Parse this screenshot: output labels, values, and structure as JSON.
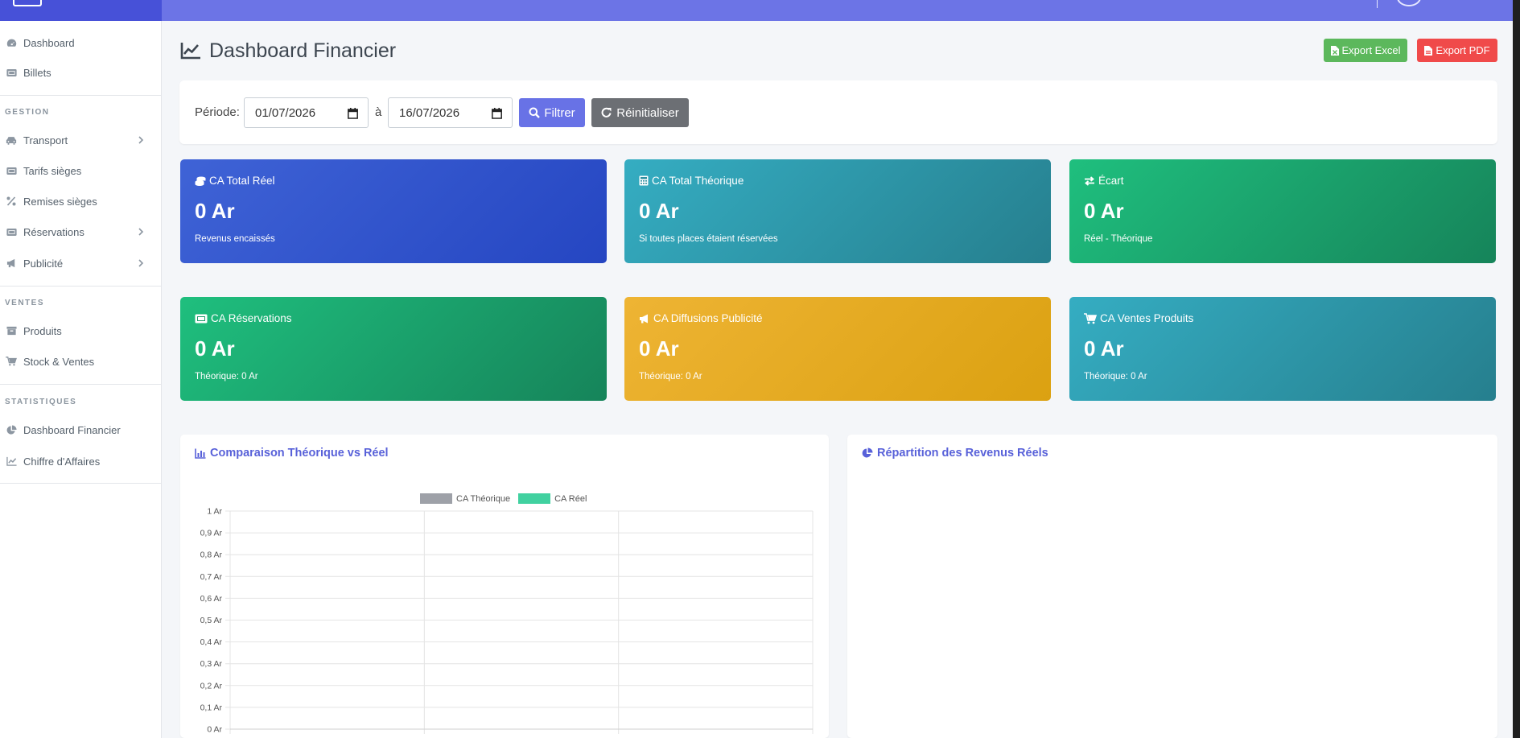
{
  "sidebar": {
    "items_top": [
      {
        "label": "Dashboard",
        "icon": "dashboard-icon"
      },
      {
        "label": "Billets",
        "icon": "ticket-icon"
      }
    ],
    "sections": [
      {
        "title": "GESTION",
        "items": [
          {
            "label": "Transport",
            "icon": "car-icon",
            "has_children": true
          },
          {
            "label": "Tarifs sièges",
            "icon": "ticket-icon",
            "has_children": false
          },
          {
            "label": "Remises sièges",
            "icon": "percent-icon",
            "has_children": false
          },
          {
            "label": "Réservations",
            "icon": "ticket-icon",
            "has_children": true
          },
          {
            "label": "Publicité",
            "icon": "megaphone-icon",
            "has_children": true
          }
        ]
      },
      {
        "title": "VENTES",
        "items": [
          {
            "label": "Produits",
            "icon": "box-icon",
            "has_children": false
          },
          {
            "label": "Stock & Ventes",
            "icon": "cart-icon",
            "has_children": false
          }
        ]
      },
      {
        "title": "STATISTIQUES",
        "items": [
          {
            "label": "Dashboard Financier",
            "icon": "pie-chart-icon",
            "has_children": false
          },
          {
            "label": "Chiffre d'Affaires",
            "icon": "line-chart-icon",
            "has_children": false
          }
        ]
      }
    ]
  },
  "header": {
    "title": "Dashboard Financier",
    "export_excel": "Export Excel",
    "export_pdf": "Export PDF"
  },
  "filter": {
    "periode_label": "Période:",
    "date_from": "01/07/2026",
    "separator": "à",
    "date_to": "16/07/2026",
    "filter_button": "Filtrer",
    "reset_button": "Réinitialiser"
  },
  "stats": [
    {
      "title": "CA Total Réel",
      "value": "0 Ar",
      "sub": "Revenus encaissés",
      "icon": "coins-icon",
      "color_from": "#3f63d6",
      "color_to": "#2546c2"
    },
    {
      "title": "CA Total Théorique",
      "value": "0 Ar",
      "sub": "Si toutes places étaient réservées",
      "icon": "calculator-icon",
      "color_from": "#35adc2",
      "color_to": "#267f8e"
    },
    {
      "title": "Écart",
      "value": "0 Ar",
      "sub": "Réel - Théorique",
      "icon": "exchange-icon",
      "color_from": "#1fbf7e",
      "color_to": "#16845a"
    },
    {
      "title": "CA Réservations",
      "value": "0 Ar",
      "sub": "Théorique: 0 Ar",
      "icon": "ticket-icon",
      "color_from": "#1fbf7e",
      "color_to": "#16845a"
    },
    {
      "title": "CA Diffusions Publicité",
      "value": "0 Ar",
      "sub": "Théorique: 0 Ar",
      "icon": "megaphone-icon",
      "color_from": "#eeb434",
      "color_to": "#dba111"
    },
    {
      "title": "CA Ventes Produits",
      "value": "0 Ar",
      "sub": "Théorique: 0 Ar",
      "icon": "cart-icon",
      "color_from": "#35adc2",
      "color_to": "#267f8e"
    }
  ],
  "panels": {
    "comparison_title": "Comparaison Théorique vs Réel",
    "distribution_title": "Répartition des Revenus Réels"
  },
  "chart_data": {
    "type": "bar",
    "categories": [
      "",
      "",
      ""
    ],
    "series": [
      {
        "name": "CA Théorique",
        "values": [
          0,
          0,
          0
        ],
        "color": "#9ea1a8"
      },
      {
        "name": "CA Réel",
        "values": [
          0,
          0,
          0
        ],
        "color": "#41d1a0"
      }
    ],
    "ylim": [
      0,
      1
    ],
    "yticks": [
      "0 Ar",
      "0,1 Ar",
      "0,2 Ar",
      "0,3 Ar",
      "0,4 Ar",
      "0,5 Ar",
      "0,6 Ar",
      "0,7 Ar",
      "0,8 Ar",
      "0,9 Ar",
      "1 Ar"
    ],
    "grid": true,
    "legend": "top-center"
  }
}
